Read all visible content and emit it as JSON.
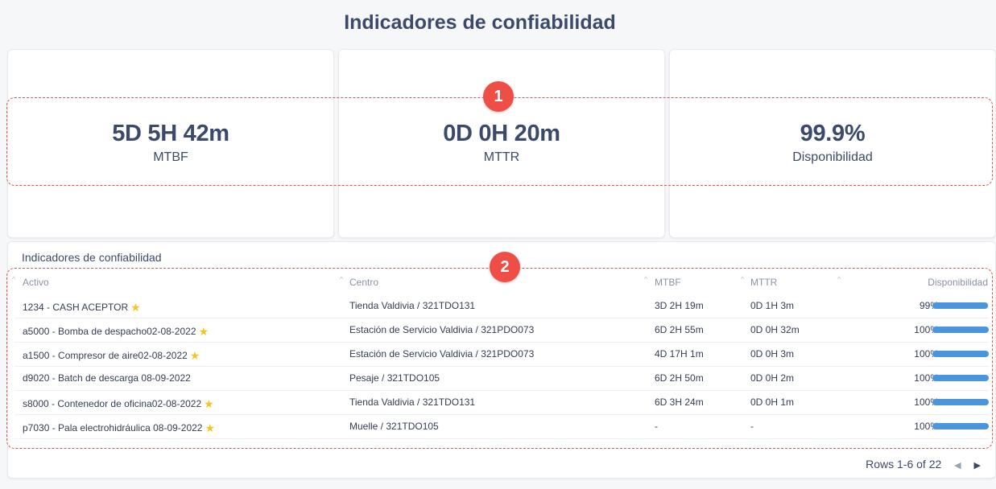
{
  "page": {
    "title": "Indicadores de confiabilidad"
  },
  "kpis": [
    {
      "value": "5D 5H 42m",
      "label": "MTBF"
    },
    {
      "value": "0D 0H 20m",
      "label": "MTTR"
    },
    {
      "value": "99.9%",
      "label": "Disponibilidad"
    }
  ],
  "annotations": {
    "badge_1": "1",
    "badge_2": "2",
    "color": "#e5544b"
  },
  "table": {
    "title": "Indicadores de confiabilidad",
    "columns": [
      "Activo",
      "Centro",
      "MTBF",
      "MTTR",
      "Disponibilidad"
    ],
    "rows": [
      {
        "activo": "1234 - CASH ACEPTOR",
        "starred": true,
        "centro": "Tienda Valdivia / 321TDO131",
        "mtbf": "3D 2H 19m",
        "mttr": "0D 1H 3m",
        "disp": "99%",
        "disp_value": 0.99
      },
      {
        "activo": "a5000 - Bomba de despacho02-08-2022",
        "starred": true,
        "centro": "Estación de Servicio Valdivia / 321PDO073",
        "mtbf": "6D 2H 55m",
        "mttr": "0D 0H 32m",
        "disp": "100%",
        "disp_value": 1.0
      },
      {
        "activo": "a1500 - Compresor de aire02-08-2022",
        "starred": true,
        "centro": "Estación de Servicio Valdivia / 321PDO073",
        "mtbf": "4D 17H 1m",
        "mttr": "0D 0H 3m",
        "disp": "100%",
        "disp_value": 1.0
      },
      {
        "activo": "d9020 - Batch de descarga 08-09-2022",
        "starred": false,
        "centro": "Pesaje / 321TDO105",
        "mtbf": "6D 2H 50m",
        "mttr": "0D 0H 2m",
        "disp": "100%",
        "disp_value": 1.0
      },
      {
        "activo": "s8000 - Contenedor de oficina02-08-2022",
        "starred": true,
        "centro": "Tienda Valdivia / 321TDO131",
        "mtbf": "6D 3H 24m",
        "mttr": "0D 0H 1m",
        "disp": "100%",
        "disp_value": 1.0
      },
      {
        "activo": "p7030 - Pala electrohidráulica 08-09-2022",
        "starred": true,
        "centro": "Muelle / 321TDO105",
        "mtbf": "-",
        "mttr": "-",
        "disp": "100%",
        "disp_value": 1.0
      }
    ],
    "pagination": {
      "label": "Rows 1-6 of 22"
    }
  },
  "icons": {
    "star": "star-icon",
    "sort": "sort-arrow-icon",
    "prev": "chevron-left-icon",
    "next": "chevron-right-icon"
  },
  "colors": {
    "accent": "#4a95dc",
    "star": "#f3c623",
    "text": "#3b4a6b"
  }
}
